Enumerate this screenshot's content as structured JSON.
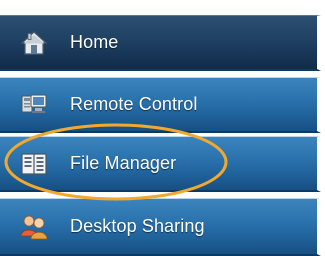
{
  "menu": {
    "items": [
      {
        "label": "Home",
        "icon": "home-icon"
      },
      {
        "label": "Remote Control",
        "icon": "remote-control-icon"
      },
      {
        "label": "File Manager",
        "icon": "file-manager-icon"
      },
      {
        "label": "Desktop Sharing",
        "icon": "desktop-sharing-icon"
      }
    ]
  },
  "colors": {
    "active_bg": "#1f4163",
    "item_bg": "#2b73ae",
    "label": "#ffffff",
    "highlight": "#f0a830"
  }
}
